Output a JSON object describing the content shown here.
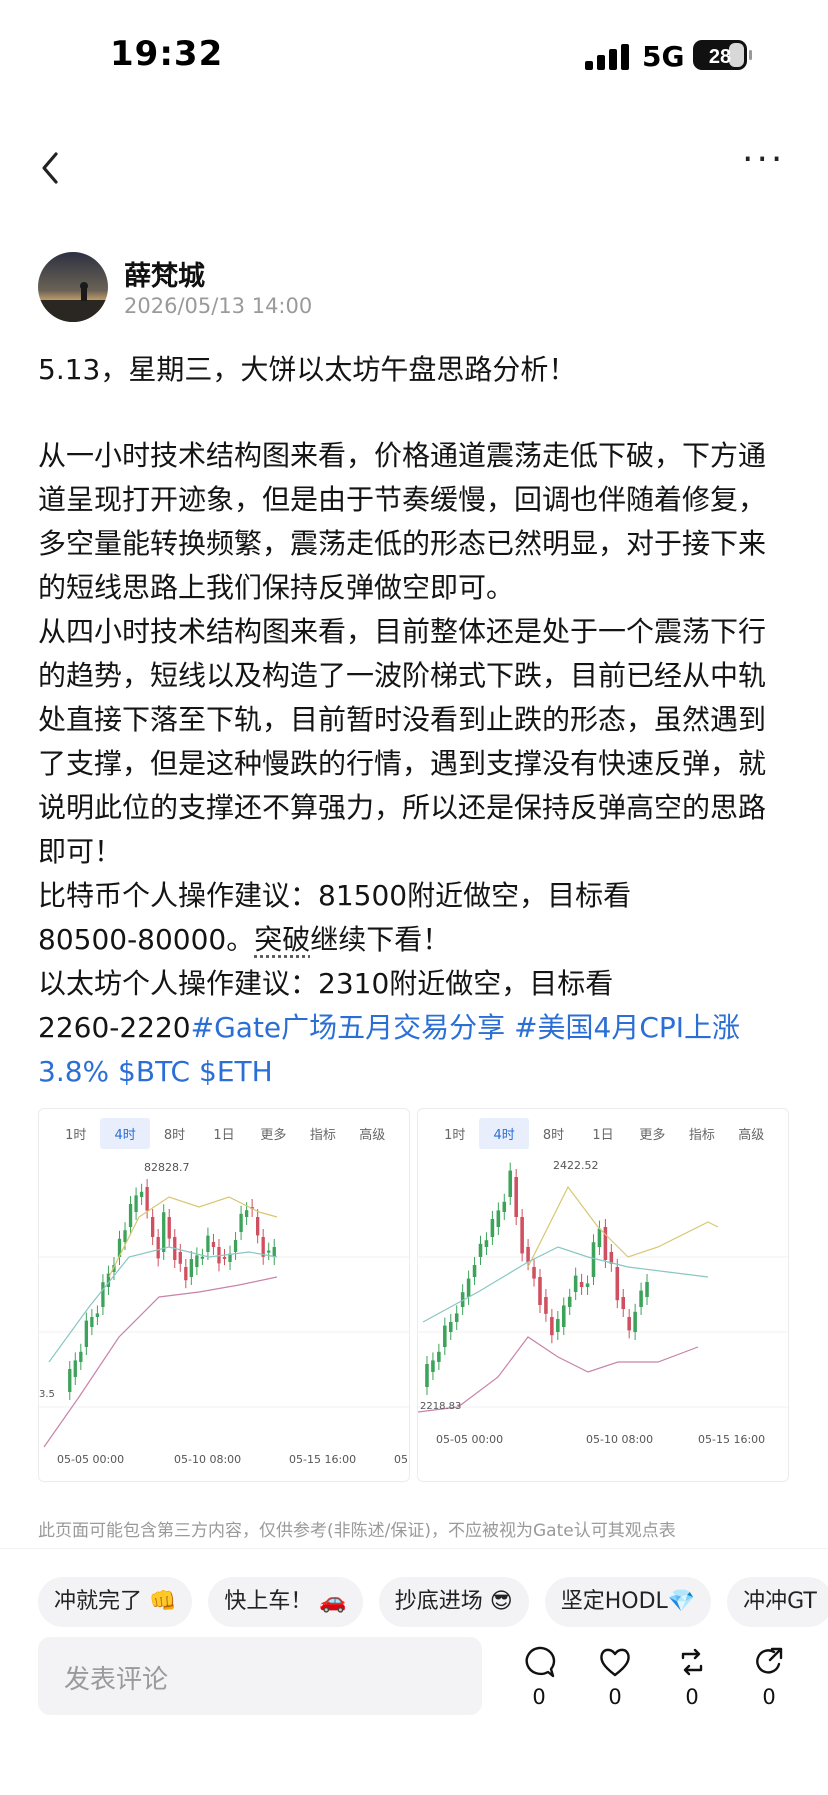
{
  "status_bar": {
    "time": "19:32",
    "network": "5G",
    "battery": "28"
  },
  "post": {
    "author": "薛梵城",
    "date": "2026/05/13 14:00",
    "headline": "5.13，星期三，大饼以太坊午盘思路分析！",
    "lines": [
      "从一小时技术结构图来看，价格通道震荡走低下破，下方通",
      "道呈现打开迹象，但是由于节奏缓慢，回调也伴随着修复，",
      "多空量能转换频繁，震荡走低的形态已然明显，对于接下来",
      "的短线思路上我们保持反弹做空即可。",
      "从四小时技术结构图来看，目前整体还是处于一个震荡下行",
      "的趋势，短线以及构造了一波阶梯式下跌，目前已经从中轨",
      "处直接下落至下轨，目前暂时没看到止跌的形态，虽然遇到",
      "了支撑，但是这种慢跌的行情，遇到支撑没有快速反弹，就",
      "说明此位的支撑还不算强力，所以还是保持反弹高空的思路",
      "即可！",
      "比特币个人操作建议：81500附近做空，目标看"
    ],
    "line_btc_target_a": "80500-80000。",
    "line_btc_target_dotted": "突破",
    "line_btc_target_b": "继续下看！",
    "line_eth": "以太坊个人操作建议：2310附近做空，目标看",
    "line_eth_target": "2260-2220",
    "tag1": "#Gate广场五月交易分享",
    "tag2": "#美国4月CPI上涨",
    "tag2b": "3.8%",
    "tag3": "$BTC",
    "tag4": "$ETH"
  },
  "charts": [
    {
      "tabs": [
        "1时",
        "4时",
        "8时",
        "1日",
        "更多",
        "指标",
        "高级"
      ],
      "active_tab": "4时",
      "high_label": "82828.7",
      "low_label": "3.5",
      "x_labels": [
        "05-05 00:00",
        "05-10 08:00",
        "05-15 16:00",
        "05"
      ]
    },
    {
      "tabs": [
        "1时",
        "4时",
        "8时",
        "1日",
        "更多",
        "指标",
        "高级"
      ],
      "active_tab": "4时",
      "high_label": "2422.52",
      "low_label": "2218.83",
      "x_labels": [
        "05-05 00:00",
        "05-10 08:00",
        "05-15 16:00"
      ]
    }
  ],
  "disclaimer": "此页面可能包含第三方内容，仅供参考(非陈述/保证)，不应被视为Gate认可其观点表",
  "reactions": [
    "冲就完了 👊",
    "快上车！ 🚗",
    "抄底进场 😎",
    "坚定HODL💎",
    "冲冲GT"
  ],
  "comment_placeholder": "发表评论",
  "actions": {
    "comments": "0",
    "likes": "0",
    "reposts": "0",
    "shares": "0"
  },
  "colors": {
    "link": "#2b6fd6",
    "up": "#3da35a",
    "down": "#d05060"
  }
}
